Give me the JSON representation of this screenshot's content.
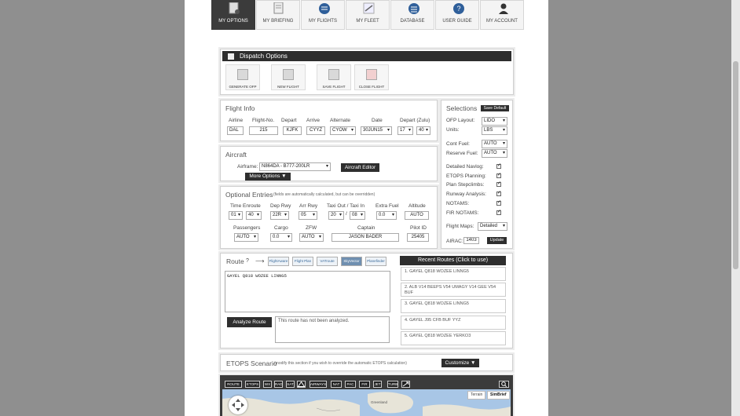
{
  "nav": {
    "tabs": [
      {
        "label": "MY OPTIONS",
        "icon": "document-gear-icon"
      },
      {
        "label": "MY BRIEFING",
        "icon": "document-icon"
      },
      {
        "label": "MY FLIGHTS",
        "icon": "list-icon"
      },
      {
        "label": "MY FLEET",
        "icon": "airplane-icon"
      },
      {
        "label": "DATABASE",
        "icon": "database-icon"
      },
      {
        "label": "USER GUIDE",
        "icon": "help-icon"
      },
      {
        "label": "MY ACCOUNT",
        "icon": "user-icon"
      }
    ]
  },
  "dispatch": {
    "title": "Dispatch Options",
    "tools": [
      "GENERATE OFP",
      "NEW FLIGHT",
      "SAVE FLIGHT",
      "CLOSE FLIGHT"
    ]
  },
  "flight_info": {
    "title": "Flight Info",
    "labels": {
      "airline": "Airline",
      "flight_no": "Flight-No.",
      "depart": "Depart",
      "arrive": "Arrive",
      "alternate": "Alternate",
      "date": "Date",
      "depart_zulu": "Depart (Zulu)"
    },
    "values": {
      "airline": "DAL",
      "flight_no": "215",
      "depart": "KJFK",
      "arrive": "CYYZ",
      "alternate": "CYOW",
      "date": "30JUN15",
      "hour": "17",
      "minute": "40"
    }
  },
  "aircraft": {
    "title": "Aircraft",
    "airframe_label": "Airframe:",
    "airframe_value": "N864DA - B777-200LR",
    "editor_button": "Aircraft Editor",
    "more_options": "More Options ▼"
  },
  "optional": {
    "title": "Optional Entries",
    "note": "(fields are automatically calculated, but can be overridden)",
    "labels": {
      "time_enroute": "Time Enroute",
      "dep_rwy": "Dep Rwy",
      "arr_rwy": "Arr Rwy",
      "taxi": "Taxi Out / Taxi In",
      "extra_fuel": "Extra Fuel",
      "altitude": "Altitude",
      "passengers": "Passengers",
      "cargo": "Cargo",
      "zfw": "ZFW",
      "captain": "Captain",
      "pilot_id": "Pilot ID"
    },
    "values": {
      "te_h": "01",
      "te_m": "40",
      "dep_rwy": "22R",
      "arr_rwy": "05",
      "taxi_out": "20",
      "taxi_sep": "/",
      "taxi_in": "08",
      "extra_fuel": "0.0",
      "altitude": "AUTO",
      "passengers": "AUTO",
      "cargo": "0.0",
      "zfw": "AUTO",
      "captain": "JASON BADER",
      "pilot_id": "25405"
    }
  },
  "selections": {
    "title": "Selections",
    "save_default": "Save Default",
    "ofp_layout_label": "OFP Layout:",
    "ofp_layout": "LIDO",
    "units_label": "Units:",
    "units": "LBS",
    "cont_fuel_label": "Cont Fuel:",
    "cont_fuel": "AUTO",
    "reserve_fuel_label": "Reserve Fuel:",
    "reserve_fuel": "AUTO",
    "checks": [
      "Detailed Navlog:",
      "ETOPS Planning:",
      "Plan Stepclimbs:",
      "Runway Analysis:",
      "NOTAMS:",
      "FIR NOTAMS:"
    ],
    "flight_maps_label": "Flight Maps:",
    "flight_maps": "Detailed",
    "airac_label": "AIRAC:",
    "airac": "1403",
    "update_button": "Update"
  },
  "route": {
    "title": "Route",
    "help": "?",
    "arrow": "⟶",
    "planners": [
      "FlightAware",
      "Flight Plan",
      "VATroute",
      "SkyVector",
      "Planefinder"
    ],
    "text": "GAYEL Q818 WOZEE LINNG5",
    "analyze_button": "Analyze Route ►",
    "analysis_text": "This route has not been analyzed.",
    "recent_title": "Recent Routes (Click to use)",
    "recent": [
      "1.   GAYEL Q818 WOZEE LINNG5",
      "2.   ALB V14 BEEPS V54 UMAGY V14 GEE V54 BUF",
      "3.   GAYEL Q818 WOZEE LINNG5",
      "4.   GAYEL J95 CFB BUF YYZ",
      "5.   GAYEL Q818 WOZEE YERKO3"
    ]
  },
  "etops": {
    "title": "ETOPS Scenario",
    "note": "(modify this section if you wish to override the automatic ETOPS calculation)",
    "customize": "Customize ▼"
  },
  "map": {
    "terrain": "Terrain",
    "simbrief": "SimBrief",
    "place": "Greenland",
    "tools": [
      "ROUTE",
      "ETOPS",
      "WX",
      "RAD",
      "SAT",
      "AIRWAYS",
      "NAT",
      "PAC",
      "FIR",
      "JET",
      "TURB"
    ]
  }
}
